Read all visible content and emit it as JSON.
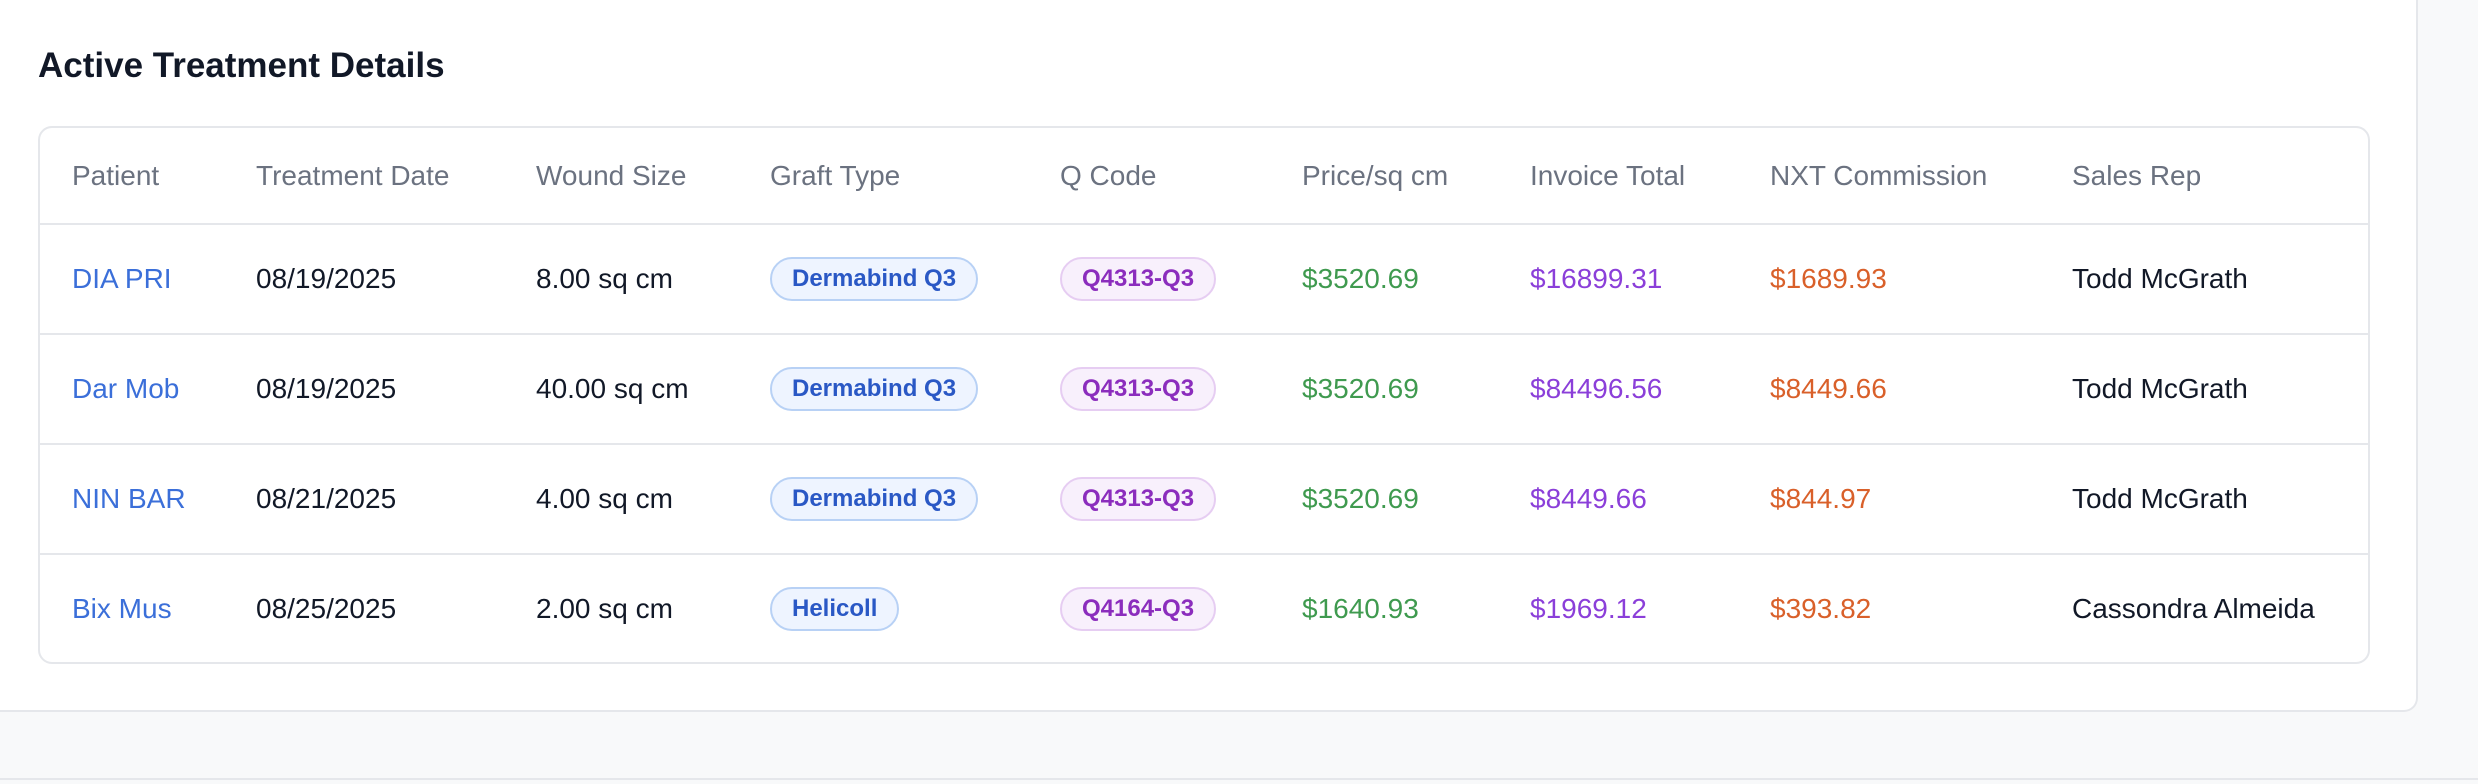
{
  "section": {
    "title": "Active Treatment Details"
  },
  "table": {
    "columns": [
      "Patient",
      "Treatment Date",
      "Wound Size",
      "Graft Type",
      "Q Code",
      "Price/sq cm",
      "Invoice Total",
      "NXT Commission",
      "Sales Rep"
    ],
    "rows": [
      {
        "patient": "DIA PRI",
        "date": "08/19/2025",
        "wound_size": "8.00 sq cm",
        "graft": "Dermabind Q3",
        "qcode": "Q4313-Q3",
        "price": "$3520.69",
        "invoice": "$16899.31",
        "commission": "$1689.93",
        "rep": "Todd McGrath"
      },
      {
        "patient": "Dar Mob",
        "date": "08/19/2025",
        "wound_size": "40.00 sq cm",
        "graft": "Dermabind Q3",
        "qcode": "Q4313-Q3",
        "price": "$3520.69",
        "invoice": "$84496.56",
        "commission": "$8449.66",
        "rep": "Todd McGrath"
      },
      {
        "patient": "NIN BAR",
        "date": "08/21/2025",
        "wound_size": "4.00 sq cm",
        "graft": "Dermabind Q3",
        "qcode": "Q4313-Q3",
        "price": "$3520.69",
        "invoice": "$8449.66",
        "commission": "$844.97",
        "rep": "Todd McGrath"
      },
      {
        "patient": "Bix Mus",
        "date": "08/25/2025",
        "wound_size": "2.00 sq cm",
        "graft": "Helicoll",
        "qcode": "Q4164-Q3",
        "price": "$1640.93",
        "invoice": "$1969.12",
        "commission": "$393.82",
        "rep": "Cassondra Almeida"
      }
    ]
  },
  "colors": {
    "patient_link": "#3b6fd9",
    "price": "#3f9a4f",
    "invoice": "#8b3fd9",
    "commission": "#d9602a"
  }
}
